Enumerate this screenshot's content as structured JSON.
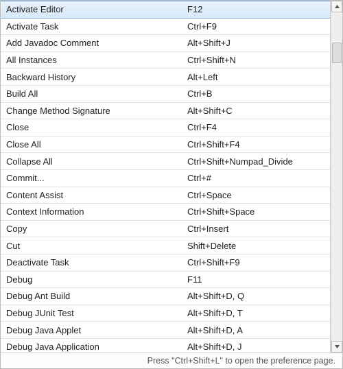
{
  "selected_index": 0,
  "bindings": [
    {
      "command": "Activate Editor",
      "key": "F12"
    },
    {
      "command": "Activate Task",
      "key": "Ctrl+F9"
    },
    {
      "command": "Add Javadoc Comment",
      "key": "Alt+Shift+J"
    },
    {
      "command": "All Instances",
      "key": "Ctrl+Shift+N"
    },
    {
      "command": "Backward History",
      "key": "Alt+Left"
    },
    {
      "command": "Build All",
      "key": "Ctrl+B"
    },
    {
      "command": "Change Method Signature",
      "key": "Alt+Shift+C"
    },
    {
      "command": "Close",
      "key": "Ctrl+F4"
    },
    {
      "command": "Close All",
      "key": "Ctrl+Shift+F4"
    },
    {
      "command": "Collapse All",
      "key": "Ctrl+Shift+Numpad_Divide"
    },
    {
      "command": "Commit...",
      "key": "Ctrl+#"
    },
    {
      "command": "Content Assist",
      "key": "Ctrl+Space"
    },
    {
      "command": "Context Information",
      "key": "Ctrl+Shift+Space"
    },
    {
      "command": "Copy",
      "key": "Ctrl+Insert"
    },
    {
      "command": "Cut",
      "key": "Shift+Delete"
    },
    {
      "command": "Deactivate Task",
      "key": "Ctrl+Shift+F9"
    },
    {
      "command": "Debug",
      "key": "F11"
    },
    {
      "command": "Debug Ant Build",
      "key": "Alt+Shift+D, Q"
    },
    {
      "command": "Debug JUnit Test",
      "key": "Alt+Shift+D, T"
    },
    {
      "command": "Debug Java Applet",
      "key": "Alt+Shift+D, A"
    },
    {
      "command": "Debug Java Application",
      "key": "Alt+Shift+D, J"
    }
  ],
  "status_hint": "Press \"Ctrl+Shift+L\" to open the preference page."
}
